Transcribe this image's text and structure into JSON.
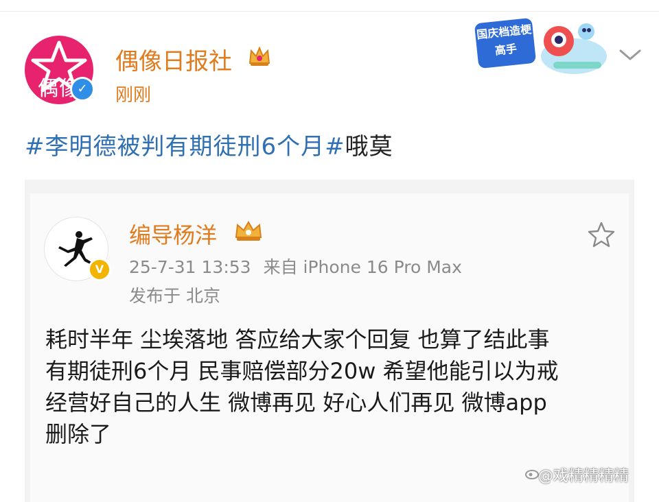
{
  "post": {
    "author": "偶像日报社",
    "avatar_text": "偶像",
    "time": "刚刚",
    "hashtag": "#李明德被判有期徒刑6个月#",
    "extra_text": "哦莫",
    "promo_text": "国庆档造梗高手"
  },
  "repost": {
    "author": "编导杨洋",
    "timestamp": "25-7-31 13:53",
    "source": "来自 iPhone 16 Pro Max",
    "location": "发布于 北京",
    "lines": [
      "耗时半年 尘埃落地 答应给大家个回复 也算了结此事",
      "有期徒刑6个月 民事赔偿部分20w 希望他能引以为戒",
      "经营好自己的人生 微博再见 好心人们再见 微博app",
      "删除了"
    ]
  },
  "watermark": "@戏精精精精",
  "colors": {
    "accent_orange": "#e07b1e",
    "hashtag_blue": "#2f6fb3",
    "avatar_pink": "#e8236d",
    "verify_blue": "#2f8ee6",
    "verify_gold": "#f3b400"
  },
  "icons": [
    "crown-icon",
    "chevron-down-icon",
    "star-icon",
    "verified-icon",
    "jumpman-logo-icon"
  ]
}
